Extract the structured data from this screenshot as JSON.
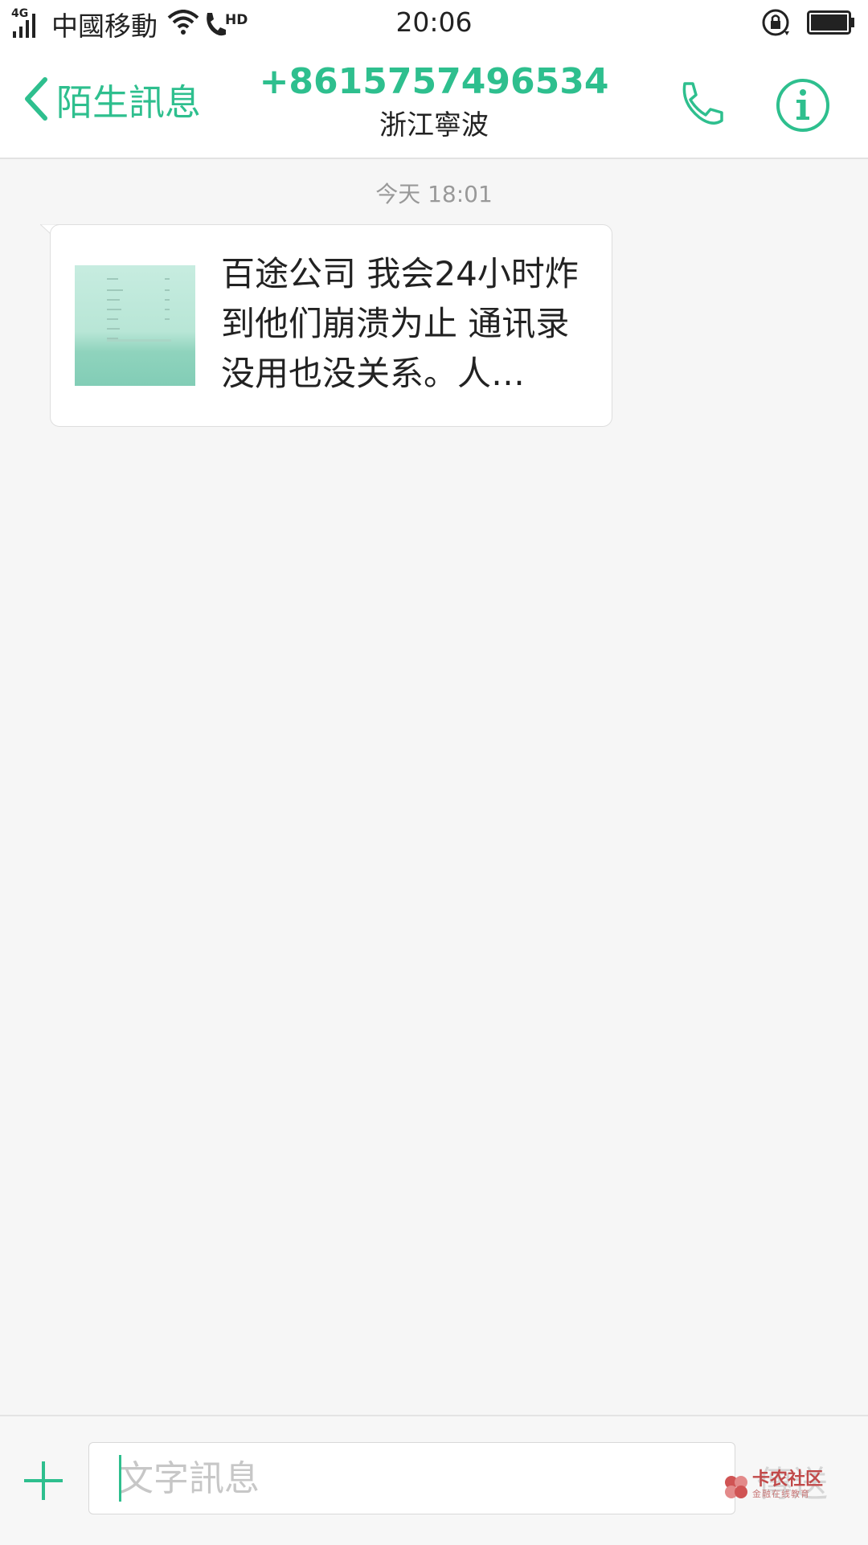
{
  "status_bar": {
    "network_tag": "4G",
    "carrier": "中國移動",
    "hd_label": "HD",
    "time": "20:06"
  },
  "header": {
    "back_label": "陌生訊息",
    "contact_number": "+8615757496534",
    "contact_location": "浙江寧波"
  },
  "conversation": {
    "timestamp": "今天 18:01",
    "messages": [
      {
        "text": "百途公司 我会24小时炸到他们崩溃为止 通讯录没用也没关系。人…",
        "has_thumbnail": true
      }
    ]
  },
  "composer": {
    "placeholder": "文字訊息",
    "send_label": "傳送"
  },
  "watermark": {
    "main": "卡农社区",
    "sub": "金融在线教育"
  },
  "colors": {
    "accent": "#2ebf8e",
    "background": "#f6f6f6",
    "bubble": "#ffffff"
  },
  "icons": [
    "signal-icon",
    "wifi-icon",
    "hd-call-icon",
    "rotation-lock-icon",
    "battery-icon",
    "back-chevron-icon",
    "phone-icon",
    "info-icon",
    "plus-icon"
  ]
}
